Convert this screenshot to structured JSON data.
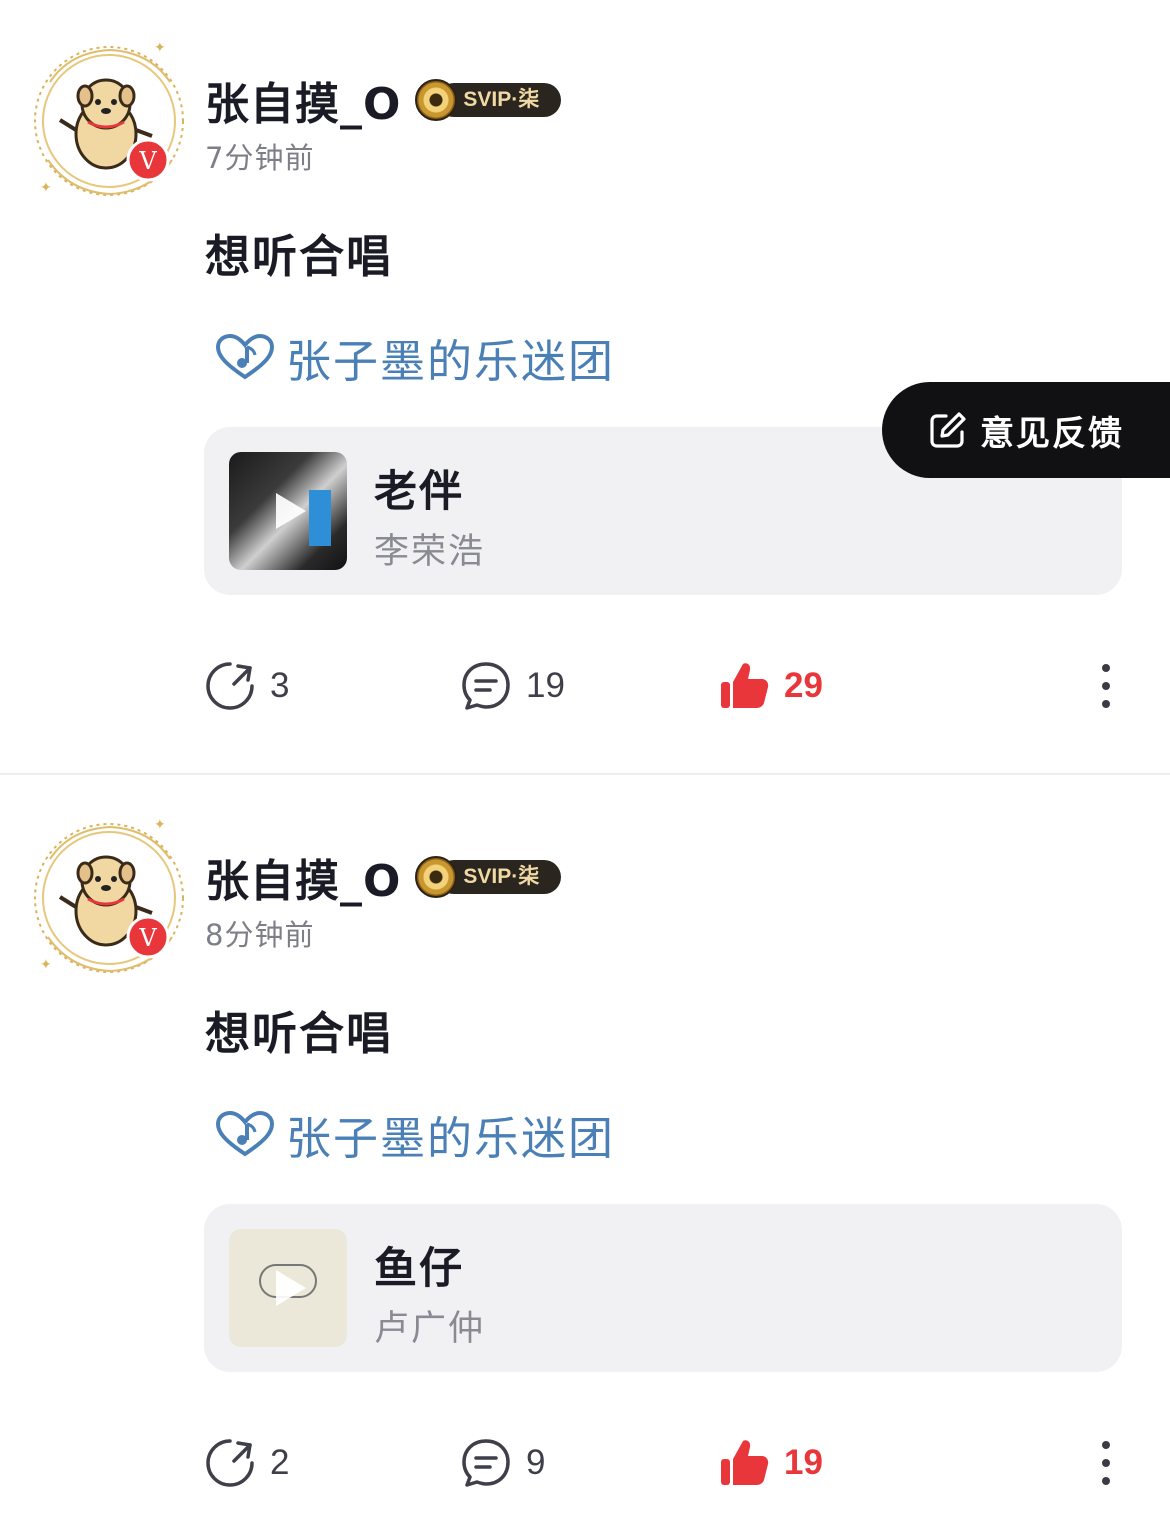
{
  "posts": [
    {
      "username": "张自摸_O",
      "vip_badge": "SVIP·柒",
      "time": "7分钟前",
      "text": "想听合唱",
      "fan_group": "张子墨的乐迷团",
      "song": {
        "title": "老伴",
        "artist": "李荣浩"
      },
      "shares": "3",
      "comments": "19",
      "likes": "29"
    },
    {
      "username": "张自摸_O",
      "vip_badge": "SVIP·柒",
      "time": "8分钟前",
      "text": "想听合唱",
      "fan_group": "张子墨的乐迷团",
      "song": {
        "title": "鱼仔",
        "artist": "卢广仲"
      },
      "shares": "2",
      "comments": "9",
      "likes": "19"
    }
  ],
  "feedback_button": {
    "label": "意见反馈"
  },
  "colors": {
    "like_red": "#e8363a",
    "fan_blue": "#4a80b5",
    "verified_red": "#e8363a"
  }
}
